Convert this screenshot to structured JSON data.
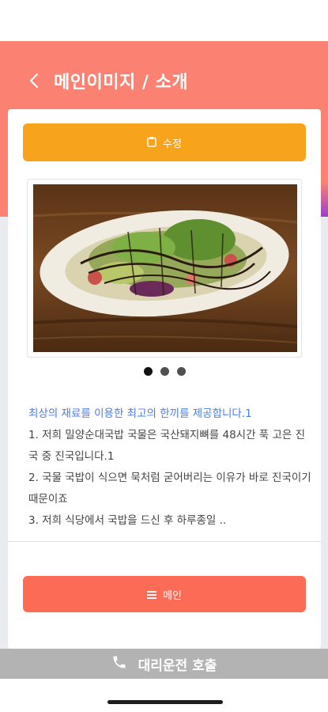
{
  "header": {
    "title": "메인이미지 / 소개"
  },
  "edit_button": {
    "label": "수정",
    "color": "#f7a31b"
  },
  "gallery": {
    "image_subject": "food photo: salad with greens and balsamic drizzle on a white oval plate on a wooden table",
    "dot_count": 3,
    "active_index": 0
  },
  "description": {
    "headline": "최상의 재료를 이용한 최고의 한끼를 제공합니다.1",
    "body": "1. 저희 밀양순대국밥 국물은 국산돼지뼈를 48시간 푹 고은 진국 중 진국입니다.1\n2. 국물 국밥이 식으면 묵처럼 굳어버리는 이유가 바로 진국이기 때문이죠\n3. 저희 식당에서 국밥을 드신 후 하루종일 .."
  },
  "menu_button": {
    "label": "메인",
    "color": "#fb6b55"
  },
  "call_bar": {
    "label": "대리운전 호출"
  },
  "colors": {
    "header": "#fb8173",
    "background": "#eaeaf1",
    "link": "#4a7de8"
  }
}
